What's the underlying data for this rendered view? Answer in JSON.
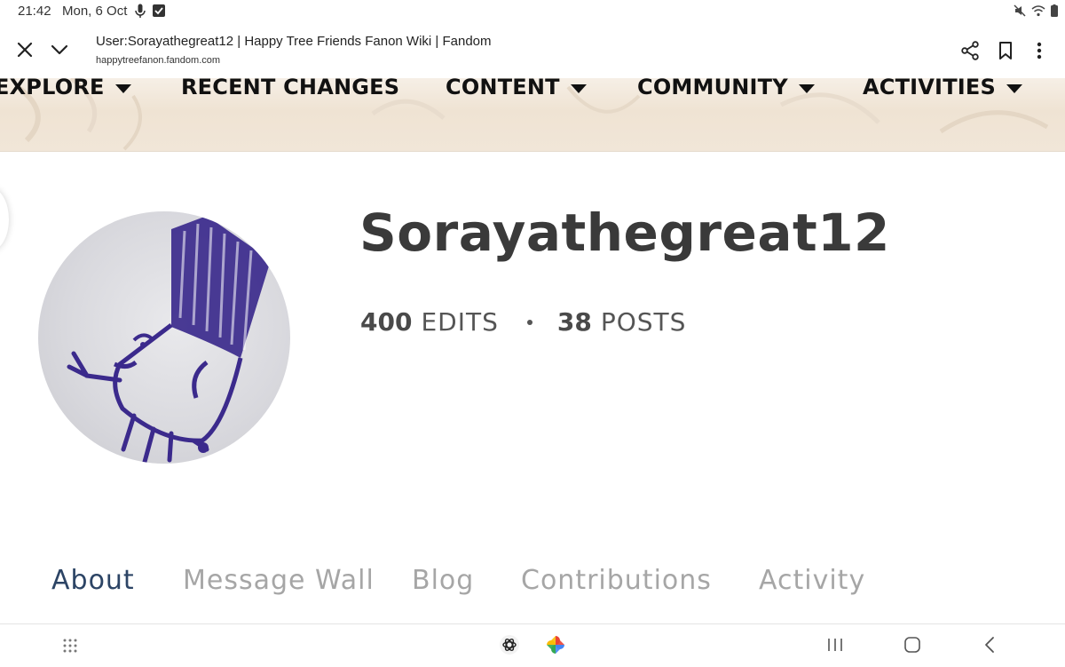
{
  "status_bar": {
    "time": "21:42",
    "date": "Mon, 6 Oct",
    "icons": [
      "mic-icon",
      "checkbox-icon",
      "mute-icon",
      "wifi-icon",
      "battery-icon"
    ]
  },
  "browser": {
    "page_title": "User:Sorayathegreat12 | Happy Tree Friends Fanon Wiki | Fandom",
    "url": "happytreefanon.fandom.com",
    "icons": [
      "close-icon",
      "chevron-down-icon",
      "share-icon",
      "bookmark-icon",
      "more-vert-icon"
    ]
  },
  "wiki_nav": {
    "items": [
      {
        "label": "EXPLORE",
        "dropdown": true
      },
      {
        "label": "RECENT CHANGES",
        "dropdown": false
      },
      {
        "label": "CONTENT",
        "dropdown": true
      },
      {
        "label": "COMMUNITY",
        "dropdown": true
      },
      {
        "label": "ACTIVITIES",
        "dropdown": true
      }
    ]
  },
  "profile": {
    "username": "Sorayathegreat12",
    "edits_count": "400",
    "edits_label": "EDITS",
    "posts_count": "38",
    "posts_label": "POSTS"
  },
  "tabs": [
    {
      "label": "About",
      "active": true
    },
    {
      "label": "Message Wall",
      "active": false
    },
    {
      "label": "Blog",
      "active": false
    },
    {
      "label": "Contributions",
      "active": false
    },
    {
      "label": "Activity",
      "active": false
    }
  ],
  "bottom_bar": {
    "icons": [
      "app-grid-icon",
      "chatgpt-icon",
      "photos-icon",
      "recents-icon",
      "home-icon",
      "back-icon"
    ]
  },
  "colors": {
    "active_tab": "#2c4465",
    "inactive_tab": "#a6a6a6",
    "avatar_drawing": "#3b2a8c"
  }
}
